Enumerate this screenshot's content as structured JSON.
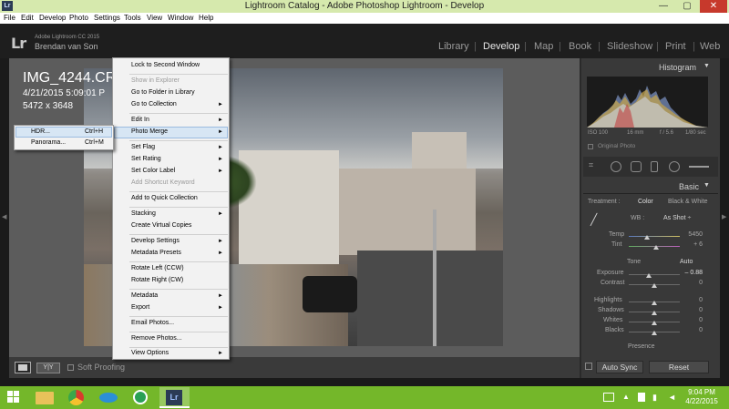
{
  "window": {
    "title": "Lightroom Catalog - Adobe Photoshop Lightroom - Develop",
    "minimize": "—",
    "maximize": "▢",
    "close": "✕"
  },
  "menubar": [
    "File",
    "Edit",
    "Develop",
    "Photo",
    "Settings",
    "Tools",
    "View",
    "Window",
    "Help"
  ],
  "identity": {
    "logo": "Lr",
    "product": "Adobe Lightroom CC 2015",
    "user": "Brendan van Son"
  },
  "modules": [
    "Library",
    "Develop",
    "Map",
    "Book",
    "Slideshow",
    "Print",
    "Web"
  ],
  "active_module": "Develop",
  "image_info": {
    "filename": "IMG_4244.CR",
    "datetime": "4/21/2015 5:09:01 P",
    "dimensions": "5472 x 3648"
  },
  "context_menu": {
    "items": [
      {
        "label": "Lock to Second Window",
        "disabled": false,
        "submenu": false
      },
      {
        "label": "Show in Explorer",
        "disabled": true,
        "submenu": false
      },
      {
        "label": "Go to Folder in Library",
        "disabled": false,
        "submenu": false
      },
      {
        "label": "Go to Collection",
        "disabled": false,
        "submenu": true
      },
      {
        "label": "Edit In",
        "disabled": false,
        "submenu": true
      },
      {
        "label": "Photo Merge",
        "disabled": false,
        "submenu": true,
        "highlighted": true
      },
      {
        "label": "Set Flag",
        "disabled": false,
        "submenu": true
      },
      {
        "label": "Set Rating",
        "disabled": false,
        "submenu": true
      },
      {
        "label": "Set Color Label",
        "disabled": false,
        "submenu": true
      },
      {
        "label": "Add Shortcut Keyword",
        "disabled": true,
        "submenu": false
      },
      {
        "label": "Add to Quick Collection",
        "disabled": false,
        "submenu": false
      },
      {
        "label": "Stacking",
        "disabled": false,
        "submenu": true
      },
      {
        "label": "Create Virtual Copies",
        "disabled": false,
        "submenu": false
      },
      {
        "label": "Develop Settings",
        "disabled": false,
        "submenu": true
      },
      {
        "label": "Metadata Presets",
        "disabled": false,
        "submenu": true
      },
      {
        "label": "Rotate Left (CCW)",
        "disabled": false,
        "submenu": false
      },
      {
        "label": "Rotate Right (CW)",
        "disabled": false,
        "submenu": false
      },
      {
        "label": "Metadata",
        "disabled": false,
        "submenu": true
      },
      {
        "label": "Export",
        "disabled": false,
        "submenu": true
      },
      {
        "label": "Email Photos...",
        "disabled": false,
        "submenu": false
      },
      {
        "label": "Remove Photos...",
        "disabled": false,
        "submenu": false
      },
      {
        "label": "View Options",
        "disabled": false,
        "submenu": true
      }
    ],
    "submenu_arrow": "►"
  },
  "photo_merge_submenu": [
    {
      "label": "HDR...",
      "shortcut": "Ctrl+H",
      "highlighted": true
    },
    {
      "label": "Panorama...",
      "shortcut": "Ctrl+M",
      "highlighted": false
    }
  ],
  "toolbar": {
    "yy_label": "Y|Y",
    "soft_proofing": "Soft Proofing"
  },
  "histogram": {
    "title": "Histogram",
    "collapse": "▼",
    "iso": "ISO 100",
    "focal": "16 mm",
    "aperture": "f / 5.6",
    "shutter": "1/80 sec",
    "original_photo": "Original Photo"
  },
  "basic": {
    "title": "Basic",
    "collapse": "▼",
    "treatment_label": "Treatment :",
    "color": "Color",
    "bw": "Black & White",
    "wb_label": "WB :",
    "wb_value": "As Shot ÷",
    "temp_label": "Temp",
    "temp_value": "5450",
    "tint_label": "Tint",
    "tint_value": "+ 6",
    "tone_label": "Tone",
    "auto": "Auto",
    "exposure_label": "Exposure",
    "exposure_value": "– 0.88",
    "contrast_label": "Contrast",
    "contrast_value": "0",
    "highlights_label": "Highlights",
    "highlights_value": "0",
    "shadows_label": "Shadows",
    "shadows_value": "0",
    "whites_label": "Whites",
    "whites_value": "0",
    "blacks_label": "Blacks",
    "blacks_value": "0",
    "presence_label": "Presence"
  },
  "bottom_buttons": {
    "auto_sync": "Auto Sync",
    "reset": "Reset"
  },
  "taskbar": {
    "time": "9:04 PM",
    "date": "4/22/2015",
    "active_app": "Lr"
  },
  "colors": {
    "taskbar": "#74b72a",
    "titlebar": "#d6e9ad",
    "menu_highlight": "#d7e6f4"
  }
}
